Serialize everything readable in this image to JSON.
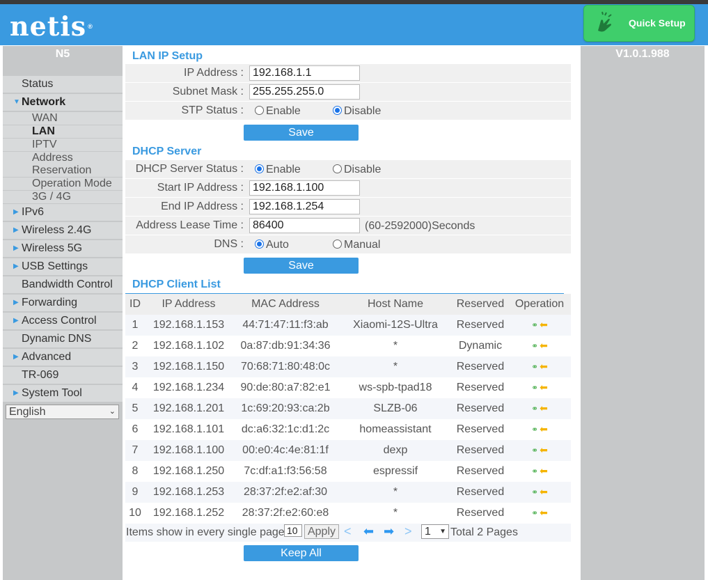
{
  "header": {
    "logo": "netis",
    "logo_mark": "®",
    "quick_setup_label": "Quick Setup"
  },
  "left_panel": {
    "model": "N5",
    "nav": [
      {
        "label": "Status",
        "has_arrow": false
      },
      {
        "label": "Network",
        "has_arrow": true,
        "expanded": true
      },
      {
        "label": "IPv6",
        "has_arrow": true
      },
      {
        "label": "Wireless 2.4G",
        "has_arrow": true
      },
      {
        "label": "Wireless 5G",
        "has_arrow": true
      },
      {
        "label": "USB Settings",
        "has_arrow": true
      },
      {
        "label": "Bandwidth Control",
        "has_arrow": false
      },
      {
        "label": "Forwarding",
        "has_arrow": true
      },
      {
        "label": "Access Control",
        "has_arrow": true
      },
      {
        "label": "Dynamic DNS",
        "has_arrow": false
      },
      {
        "label": "Advanced",
        "has_arrow": true
      },
      {
        "label": "TR-069",
        "has_arrow": false
      },
      {
        "label": "System Tool",
        "has_arrow": true
      }
    ],
    "network_sub": [
      "WAN",
      "LAN",
      "IPTV",
      "Address Reservation",
      "Operation Mode",
      "3G / 4G"
    ],
    "network_sub_current": "LAN",
    "language": "English"
  },
  "right_panel": {
    "version": "V1.0.1.988"
  },
  "lan": {
    "title": "LAN IP Setup",
    "ip_label": "IP Address :",
    "ip_value": "192.168.1.1",
    "mask_label": "Subnet Mask :",
    "mask_value": "255.255.255.0",
    "stp_label": "STP Status :",
    "stp_enable": "Enable",
    "stp_disable": "Disable",
    "stp_selected": "Disable",
    "save": "Save"
  },
  "dhcp": {
    "title": "DHCP Server",
    "status_label": "DHCP Server Status :",
    "enable": "Enable",
    "disable": "Disable",
    "status_selected": "Enable",
    "start_label": "Start IP Address :",
    "start_value": "192.168.1.100",
    "end_label": "End IP Address :",
    "end_value": "192.168.1.254",
    "lease_label": "Address Lease Time :",
    "lease_value": "86400",
    "lease_hint": "(60-2592000)Seconds",
    "dns_label": "DNS :",
    "dns_auto": "Auto",
    "dns_manual": "Manual",
    "dns_selected": "Auto",
    "save": "Save"
  },
  "client_list": {
    "title": "DHCP Client List",
    "columns": [
      "ID",
      "IP Address",
      "MAC Address",
      "Host Name",
      "Reserved",
      "Operation"
    ],
    "rows": [
      [
        "1",
        "192.168.1.153",
        "44:71:47:11:f3:ab",
        "Xiaomi-12S-Ultra",
        "Reserved"
      ],
      [
        "2",
        "192.168.1.102",
        "0a:87:db:91:34:36",
        "*",
        "Dynamic"
      ],
      [
        "3",
        "192.168.1.150",
        "70:68:71:80:48:0c",
        "*",
        "Reserved"
      ],
      [
        "4",
        "192.168.1.234",
        "90:de:80:a7:82:e1",
        "ws-spb-tpad18",
        "Reserved"
      ],
      [
        "5",
        "192.168.1.201",
        "1c:69:20:93:ca:2b",
        "SLZB-06",
        "Reserved"
      ],
      [
        "6",
        "192.168.1.101",
        "dc:a6:32:1c:d1:2c",
        "homeassistant",
        "Reserved"
      ],
      [
        "7",
        "192.168.1.100",
        "00:e0:4c:4e:81:1f",
        "dexp",
        "Reserved"
      ],
      [
        "8",
        "192.168.1.250",
        "7c:df:a1:f3:56:58",
        "espressif",
        "Reserved"
      ],
      [
        "9",
        "192.168.1.253",
        "28:37:2f:e2:af:30",
        "*",
        "Reserved"
      ],
      [
        "10",
        "192.168.1.252",
        "28:37:2f:e2:60:e8",
        "*",
        "Reserved"
      ]
    ],
    "icons": {
      "link": "link-icon",
      "arrow": "arrow-left-icon"
    },
    "pager": {
      "text": "Items show in every single page",
      "per_page": "10",
      "apply": "Apply",
      "page": "1",
      "total": "Total 2 Pages"
    },
    "keep_all": "Keep All"
  },
  "colors": {
    "header": "#3a9ae0",
    "accent": "#3a9ae0",
    "quick_setup": "#3fce6b",
    "panel": "#c6c8c9"
  }
}
